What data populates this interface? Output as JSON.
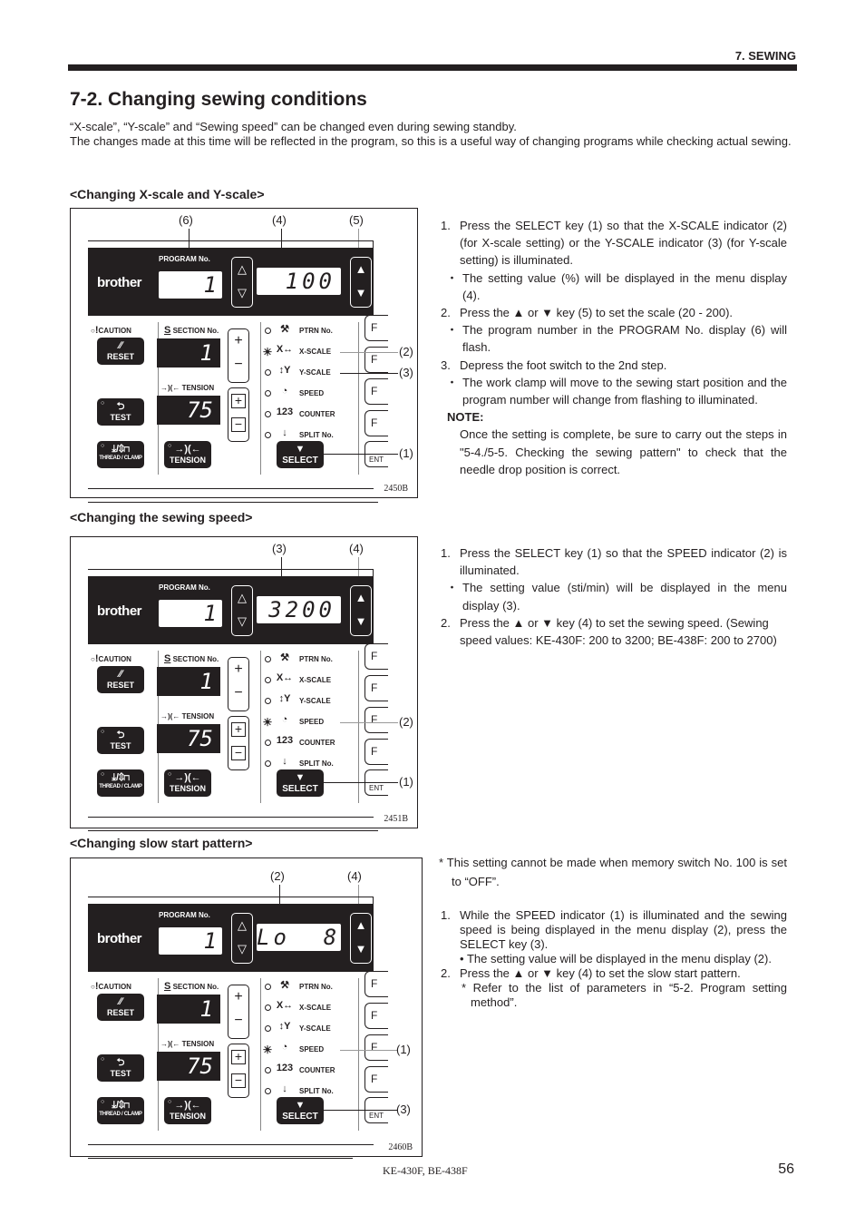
{
  "header": {
    "chapter": "7. SEWING"
  },
  "page_title": "7-2. Changing sewing conditions",
  "intro": [
    "“X-scale”, “Y-scale” and “Sewing speed” can be changed even during sewing standby.",
    "The changes made at this time will be reflected in the program, so this is a useful way of changing programs while checking actual sewing."
  ],
  "panel_common": {
    "brand": "brother",
    "program_label": "PROGRAM No.",
    "program_value": "1",
    "caution_label": "CAUTION",
    "reset_label": "RESET",
    "section_label": "SECTION No.",
    "section_value": "1",
    "tension_label": "TENSION",
    "tension_value": "75",
    "test_label": "TEST",
    "thread_clamp_label": "THREAD / CLAMP",
    "tension_key_label": "TENSION",
    "select_label": "SELECT",
    "enter_label": "ENT",
    "f_key": "F",
    "indicators": [
      {
        "icon": "pattern-icon",
        "symbol": "⚒",
        "label": "PTRN No."
      },
      {
        "icon": "x-scale-icon",
        "symbol": "X↔",
        "label": "X-SCALE"
      },
      {
        "icon": "y-scale-icon",
        "symbol": "↕Y",
        "label": "Y-SCALE"
      },
      {
        "icon": "speed-icon",
        "symbol": "◔",
        "label": "SPEED"
      },
      {
        "icon": "counter-icon",
        "symbol": "123",
        "label": "COUNTER"
      },
      {
        "icon": "needle-icon",
        "symbol": "↓",
        "label": "SPLIT No."
      }
    ]
  },
  "sections": [
    {
      "heading": "<Changing X-scale and Y-scale>",
      "figure": {
        "id": "2450B",
        "menu_value": "100",
        "lit_indicator": "X-SCALE",
        "callouts": {
          "program": "(6)",
          "menu": "(4)",
          "updown": "(5)",
          "xscale": "(2)",
          "yscale": "(3)",
          "select": "(1)"
        }
      },
      "steps": [
        {
          "num": "1.",
          "text": "Press the SELECT key (1) so that the X-SCALE indicator (2) (for X-scale setting) or the Y-SCALE indicator (3) (for Y-scale setting) is illuminated.",
          "bullets": [
            "The setting value (%) will be displayed in the menu display (4)."
          ]
        },
        {
          "num": "2.",
          "text": "Press the ▲ or ▼ key (5) to set the scale (20 - 200).",
          "bullets": [
            "The program number in the PROGRAM No. display (6) will flash."
          ]
        },
        {
          "num": "3.",
          "text": "Depress the foot switch to the 2nd step.",
          "bullets": [
            "The work clamp will move to the sewing start position and the program number will change from flashing to illuminated."
          ]
        }
      ],
      "note": {
        "heading": "NOTE:",
        "body": "Once the setting is complete, be sure to carry out the steps in \"5-4./5-5. Checking the sewing pattern\" to check that the needle drop position is correct."
      }
    },
    {
      "heading": "<Changing the sewing speed>",
      "figure": {
        "id": "2451B",
        "menu_value": "3200",
        "lit_indicator": "SPEED",
        "callouts": {
          "menu": "(3)",
          "updown": "(4)",
          "speed": "(2)",
          "select": "(1)"
        }
      },
      "steps": [
        {
          "num": "1.",
          "text": "Press the SELECT key (1) so that the SPEED indicator (2) is illuminated.",
          "bullets": [
            "The setting value (sti/min) will be displayed in the menu display (3)."
          ]
        },
        {
          "num": "2.",
          "text": "Press the ▲ or ▼ key (4) to set the sewing speed. (Sewing speed values: KE-430F: 200 to 3200; BE-438F: 200 to 2700)",
          "bullets": []
        }
      ]
    },
    {
      "heading": "<Changing slow start pattern>",
      "figure": {
        "id": "2460B",
        "menu_value": "Lo  8",
        "lit_indicator": "SPEED",
        "callouts": {
          "menu": "(2)",
          "updown": "(4)",
          "speed": "(1)",
          "select": "(3)"
        }
      },
      "precondition": "* This setting cannot be made when memory switch No. 100 is set to “OFF”.",
      "steps": [
        {
          "num": "1.",
          "text": "While the SPEED indicator (1) is illuminated and the sewing speed is being displayed in the menu display (2), press the SELECT key (3).",
          "bullets": [
            "The setting value will be displayed in the menu display (2)."
          ]
        },
        {
          "num": "2.",
          "text": "Press the ▲ or ▼ key (4) to set the slow start pattern.",
          "bullets": [
            "* Refer to the list of parameters in “5-2. Program setting method”."
          ]
        }
      ]
    }
  ],
  "footer": {
    "model": "KE-430F, BE-438F",
    "page": "56"
  }
}
